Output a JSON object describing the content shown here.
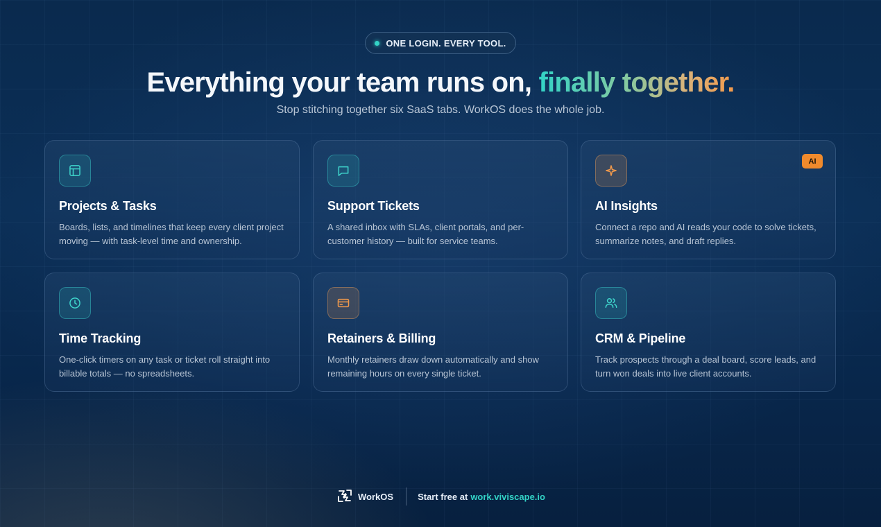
{
  "pill": {
    "text": "ONE LOGIN. EVERY TOOL."
  },
  "hero": {
    "headline_plain": "Everything your team runs on,",
    "headline_accent": "finally together.",
    "subtitle": "Stop stitching together six SaaS tabs. WorkOS does the whole job."
  },
  "cards": [
    {
      "title": "Projects & Tasks",
      "description": "Boards, lists, and timelines that keep every client project moving — with task-level time and ownership.",
      "icon": "layout-icon"
    },
    {
      "title": "Support Tickets",
      "description": "A shared inbox with SLAs, client portals, and per-customer history — built for service teams.",
      "icon": "message-icon"
    },
    {
      "title": "AI Insights",
      "description": "Connect a repo and AI reads your code to solve tickets, summarize notes, and draft replies.",
      "icon": "sparkle-icon",
      "badge": "AI"
    },
    {
      "title": "Time Tracking",
      "description": "One-click timers on any task or ticket roll straight into billable totals — no spreadsheets.",
      "icon": "clock-icon"
    },
    {
      "title": "Retainers & Billing",
      "description": "Monthly retainers draw down automatically and show remaining hours on every single ticket.",
      "icon": "credit-card-icon"
    },
    {
      "title": "CRM & Pipeline",
      "description": "Track prospects through a deal board, score leads, and turn won deals into live client accounts.",
      "icon": "users-icon"
    }
  ],
  "footer": {
    "brand": "WorkOS",
    "cta_text": "Start free at",
    "cta_link": "work.viviscape.io"
  },
  "colors": {
    "accent_teal": "#33d3c6",
    "accent_orange": "#f08a2c"
  }
}
